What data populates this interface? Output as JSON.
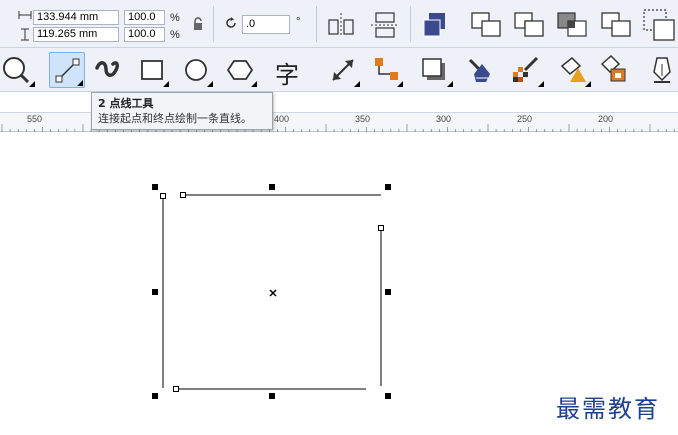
{
  "property_bar": {
    "width_value": "133.944 mm",
    "height_value": "119.265 mm",
    "scale_x": "100.0",
    "scale_y": "100.0",
    "percent_symbol": "%",
    "rotation_value": ".0",
    "degree_symbol": "°"
  },
  "tooltip": {
    "title": "2 点线工具",
    "description": "连接起点和终点绘制一条直线。"
  },
  "ruler": {
    "labels": [
      "550",
      "400",
      "350",
      "300",
      "250",
      "200"
    ]
  },
  "toolbox": {
    "text_tool_glyph": "字"
  },
  "watermark": {
    "text": "最需教育"
  },
  "colors": {
    "toolbar_bg": "#eef2f8",
    "selected_tool_bg": "#cfe4fb",
    "watermark": "#1c3f8f",
    "icon_blue": "#3a4a8c",
    "icon_orange": "#e07a1e"
  }
}
